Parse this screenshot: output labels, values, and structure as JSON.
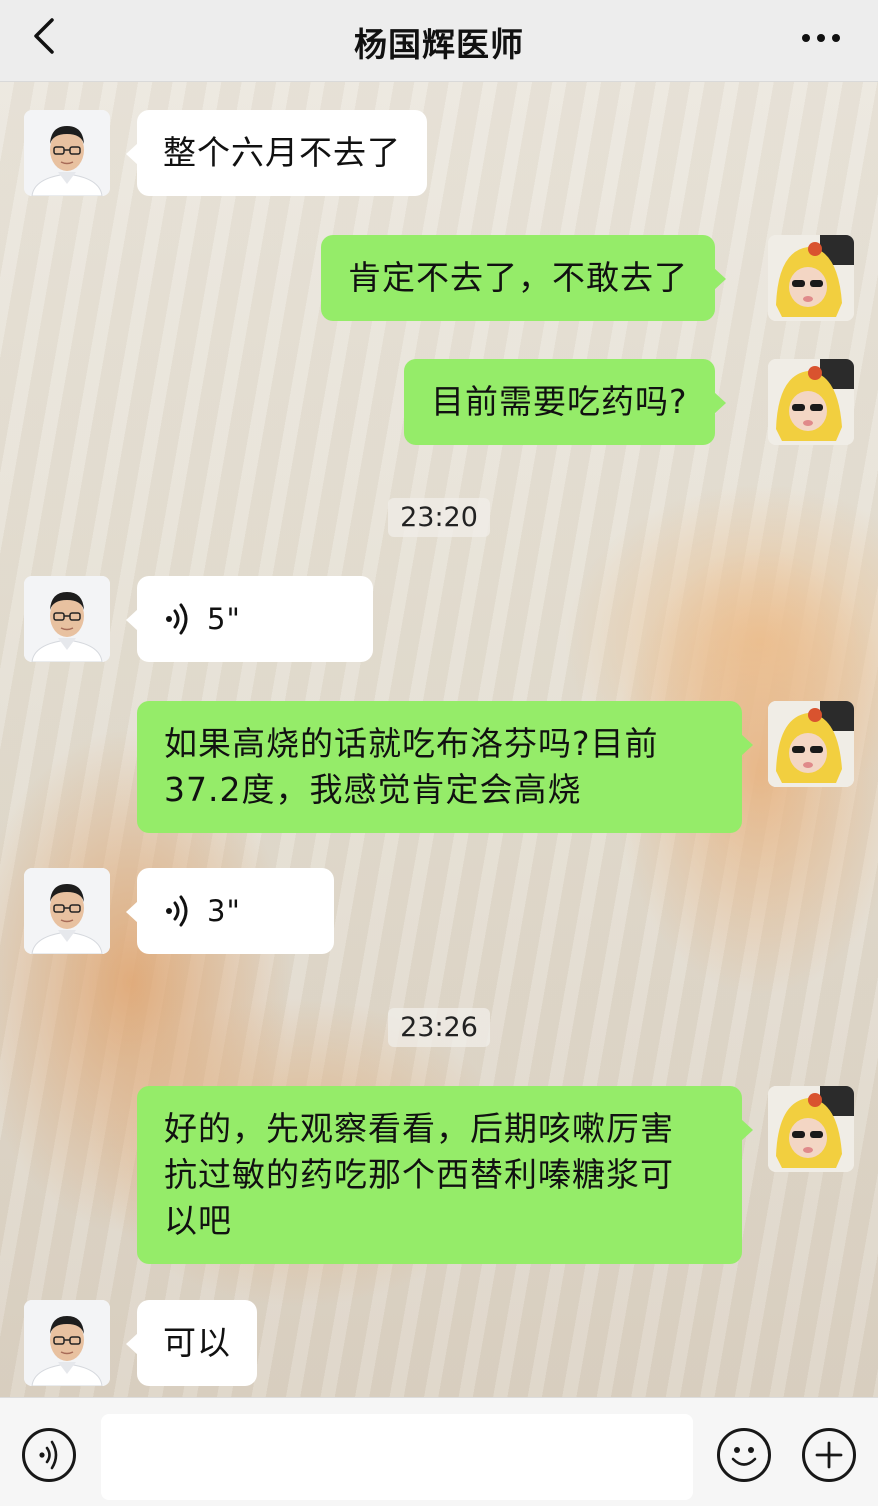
{
  "header": {
    "title": "杨国辉医师",
    "back_icon": "chevron-left-icon",
    "more_icon": "more-dots-icon"
  },
  "messages": [
    {
      "side": "in",
      "type": "text",
      "text": "整个六月不去了"
    },
    {
      "side": "out",
      "type": "text",
      "text": "肯定不去了，不敢去了"
    },
    {
      "side": "out",
      "type": "text",
      "text": "目前需要吃药吗?"
    },
    {
      "side": "time",
      "text": "23:20"
    },
    {
      "side": "in",
      "type": "voice",
      "duration": "5\""
    },
    {
      "side": "out",
      "type": "text",
      "lines": [
        "如果高烧的话就吃布洛芬吗?目前",
        "37.2度，我感觉肯定会高烧"
      ]
    },
    {
      "side": "in",
      "type": "voice",
      "duration": "3\""
    },
    {
      "side": "time",
      "text": "23:26"
    },
    {
      "side": "out",
      "type": "text",
      "lines": [
        "好的，先观察看看，后期咳嗽厉害",
        "抗过敏的药吃那个西替利嗪糖浆可",
        "以吧"
      ]
    },
    {
      "side": "in",
      "type": "text",
      "text": "可以"
    }
  ],
  "input_bar": {
    "voice_icon": "voice-input-icon",
    "emoji_icon": "emoji-icon",
    "plus_icon": "plus-icon"
  },
  "colors": {
    "outgoing_bubble": "#95ec69",
    "incoming_bubble": "#ffffff",
    "header_bg": "#ededed"
  }
}
